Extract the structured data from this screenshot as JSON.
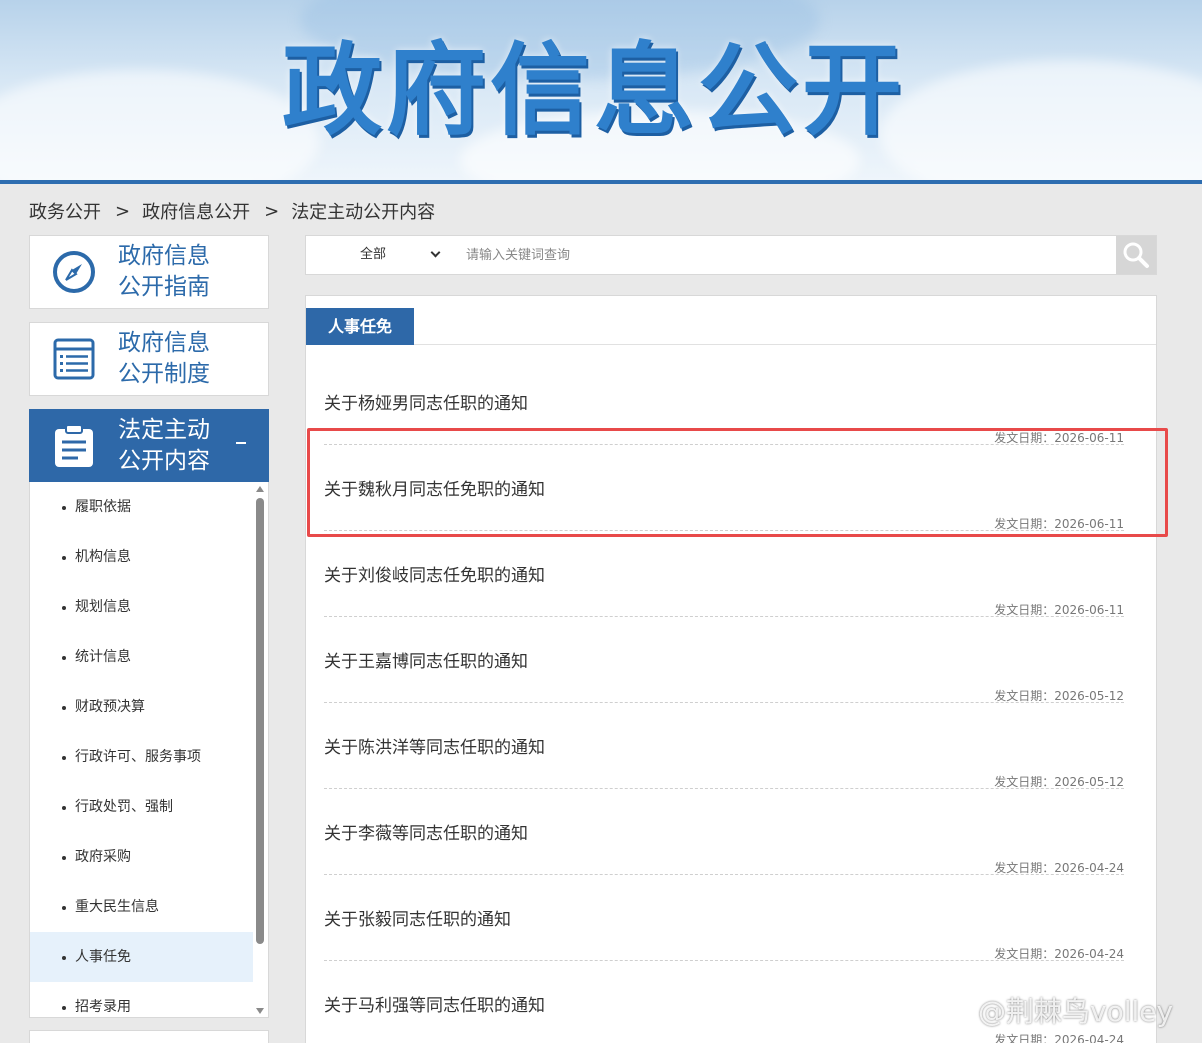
{
  "banner": {
    "title": "政府信息公开"
  },
  "breadcrumb": {
    "items": [
      "政务公开",
      "政府信息公开",
      "法定主动公开内容"
    ],
    "separator": ">"
  },
  "sidebar": {
    "cards": [
      {
        "line1": "政府信息",
        "line2": "公开指南",
        "icon": "compass-icon"
      },
      {
        "line1": "政府信息",
        "line2": "公开制度",
        "icon": "list-document-icon"
      },
      {
        "line1": "法定主动",
        "line2": "公开内容",
        "icon": "clipboard-icon",
        "toggle": "-"
      }
    ],
    "sub_items": [
      "履职依据",
      "机构信息",
      "规划信息",
      "统计信息",
      "财政预决算",
      "行政许可、服务事项",
      "行政处罚、强制",
      "政府采购",
      "重大民生信息",
      "人事任免",
      "招考录用"
    ],
    "active_sub_item": "人事任免"
  },
  "search": {
    "scope_value": "全部",
    "placeholder": "请输入关键词查询",
    "button_icon": "search-icon"
  },
  "content": {
    "tab_label": "人事任免",
    "date_prefix": "发文日期：",
    "articles": [
      {
        "title": "关于杨娅男同志任职的通知",
        "date": "发文日期：2026-06-11"
      },
      {
        "title": "关于魏秋月同志任免职的通知",
        "date": "发文日期：2026-06-11"
      },
      {
        "title": "关于刘俊岐同志任免职的通知",
        "date": "发文日期：2026-06-11"
      },
      {
        "title": "关于王嘉博同志任职的通知",
        "date": "发文日期：2026-05-12"
      },
      {
        "title": "关于陈洪洋等同志任职的通知",
        "date": "发文日期：2026-05-12"
      },
      {
        "title": "关于李薇等同志任职的通知",
        "date": "发文日期：2026-04-24"
      },
      {
        "title": "关于张毅同志任职的通知",
        "date": "发文日期：2026-04-24"
      },
      {
        "title": "关于马利强等同志任职的通知",
        "date": "发文日期：2026-04-24"
      }
    ]
  },
  "colors": {
    "accent": "#2e68a8",
    "highlight_border": "#e84a4a",
    "banner_text": "#2f80cc"
  },
  "watermark": {
    "text": "@荆棘鸟volley"
  }
}
